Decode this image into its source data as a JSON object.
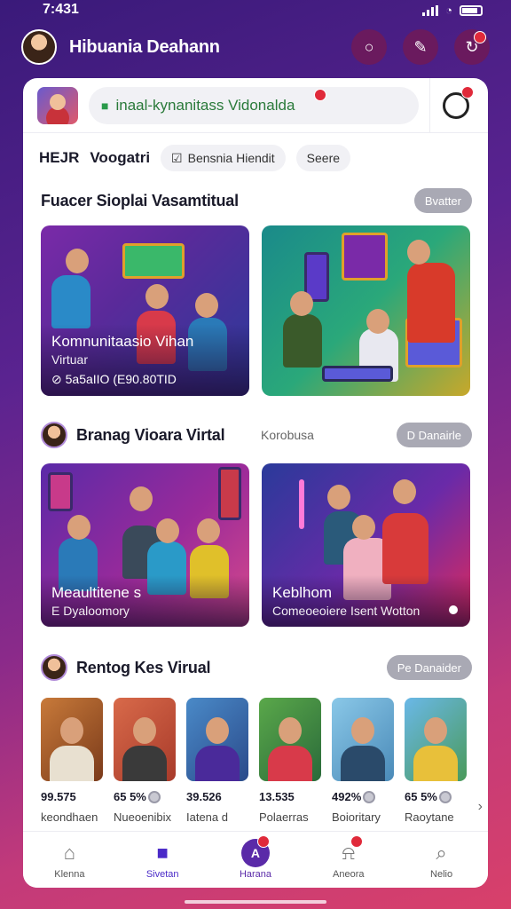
{
  "status": {
    "time": "7:431"
  },
  "header": {
    "name": "Hibuania Deahann"
  },
  "top": {
    "url_text": "inaal-kynanitass Vidonalda"
  },
  "filters": {
    "label1": "HEJR",
    "label2": "Voogatri",
    "chip1": "Bensnia Hiendit",
    "chip2": "Seere"
  },
  "section1": {
    "title": "Fuacer Sioplai Vasamtitual",
    "button": "Bvatter",
    "tile1": {
      "title": "Komnunitaasio Vihan",
      "subtitle": "Virtuar",
      "meta": "⊘ 5a5aIIO (E90.80TID"
    }
  },
  "section2": {
    "title": "Branag Vioara Virtal",
    "subtitle": "Korobusa",
    "button": "D Danairle",
    "tile1": {
      "title": "Meaultitene s",
      "subtitle": "E Dyaloomory"
    },
    "tile2": {
      "title": "Keblhom",
      "subtitle": "Comeoeoiere Isent Wotton"
    }
  },
  "section3": {
    "title": "Rentog Kes Virual",
    "button": "Pe Danaider",
    "people": [
      {
        "stat": "99.575",
        "name": "keondhaen",
        "coin": false
      },
      {
        "stat": "65 5%",
        "name": "Nueoenibix",
        "coin": true
      },
      {
        "stat": "39.526",
        "name": "Iatena d",
        "coin": false
      },
      {
        "stat": "13.535",
        "name": "Polaerras",
        "coin": false
      },
      {
        "stat": "492%",
        "name": "Boioritary",
        "coin": true
      },
      {
        "stat": "65 5%",
        "name": "Raoytane",
        "coin": true
      }
    ]
  },
  "nav": [
    {
      "label": "Klenna",
      "icon": "home-icon"
    },
    {
      "label": "Sivetan",
      "icon": "house-filled-icon"
    },
    {
      "label": "Harana",
      "icon": "profile-badge-icon",
      "center_text": "A"
    },
    {
      "label": "Aneora",
      "icon": "bell-icon"
    },
    {
      "label": "Nelio",
      "icon": "search-icon"
    }
  ],
  "colors": {
    "accent": "#4a2ac8",
    "badge": "#e02a3a",
    "pill": "#a9a9b4"
  }
}
